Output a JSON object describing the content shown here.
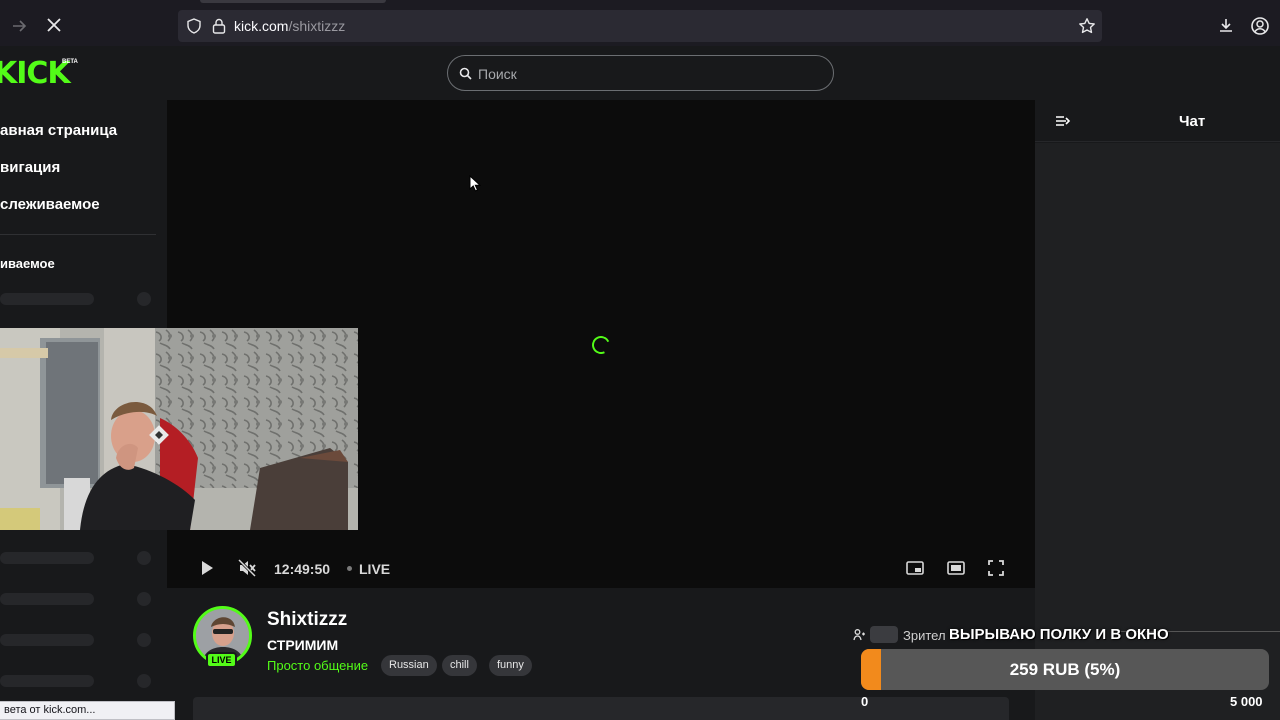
{
  "browser": {
    "url_host": "kick.com",
    "url_path": "/shixtizzz"
  },
  "header": {
    "logo": "KICK",
    "logo_badge": "BETA",
    "search_placeholder": "Поиск"
  },
  "sidebar": {
    "links": [
      "авная страница",
      "вигация",
      "слеживаемое"
    ],
    "section_title": "иваемое"
  },
  "player": {
    "timecode": "12:49:50",
    "live_label": "LIVE"
  },
  "chat": {
    "title": "Чат"
  },
  "channel": {
    "name": "Shixtizzz",
    "live_badge": "LIVE",
    "stream_title": "СТРИМИМ",
    "category": "Просто общение",
    "tags": [
      "Russian",
      "chill",
      "funny"
    ],
    "viewers_label": "Зрител"
  },
  "goal": {
    "title": "ВЫРЫВАЮ ПОЛКУ И В ОКНО",
    "progress_text": "259 RUB (5%)",
    "progress_fraction": 0.05,
    "min": "0",
    "max": "5 000"
  },
  "status_bar": {
    "text": "вета от kick.com..."
  },
  "colors": {
    "brand": "#53fc18",
    "goal_fill": "#f28a1c"
  }
}
